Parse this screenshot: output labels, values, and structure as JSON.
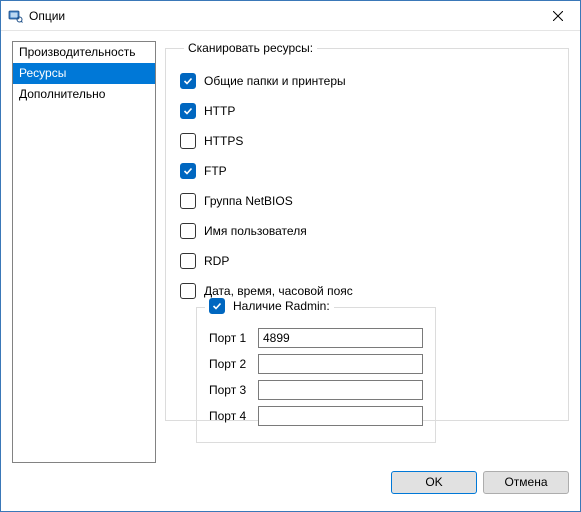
{
  "window": {
    "title": "Опции"
  },
  "sidebar": {
    "items": [
      {
        "label": "Производительность"
      },
      {
        "label": "Ресурсы"
      },
      {
        "label": "Дополнительно"
      }
    ],
    "selected_index": 1
  },
  "group": {
    "legend": "Сканировать ресурсы:",
    "options": [
      {
        "label": "Общие папки и принтеры",
        "checked": true
      },
      {
        "label": "HTTP",
        "checked": true
      },
      {
        "label": "HTTPS",
        "checked": false
      },
      {
        "label": "FTP",
        "checked": true
      },
      {
        "label": "Группа NetBIOS",
        "checked": false
      },
      {
        "label": "Имя пользователя",
        "checked": false
      },
      {
        "label": "RDP",
        "checked": false
      },
      {
        "label": "Дата, время, часовой пояс",
        "checked": false
      }
    ],
    "radmin": {
      "label": "Наличие Radmin:",
      "checked": true,
      "ports": [
        {
          "label": "Порт 1",
          "value": "4899"
        },
        {
          "label": "Порт 2",
          "value": ""
        },
        {
          "label": "Порт 3",
          "value": ""
        },
        {
          "label": "Порт 4",
          "value": ""
        }
      ]
    }
  },
  "footer": {
    "ok": "OK",
    "cancel": "Отмена"
  }
}
